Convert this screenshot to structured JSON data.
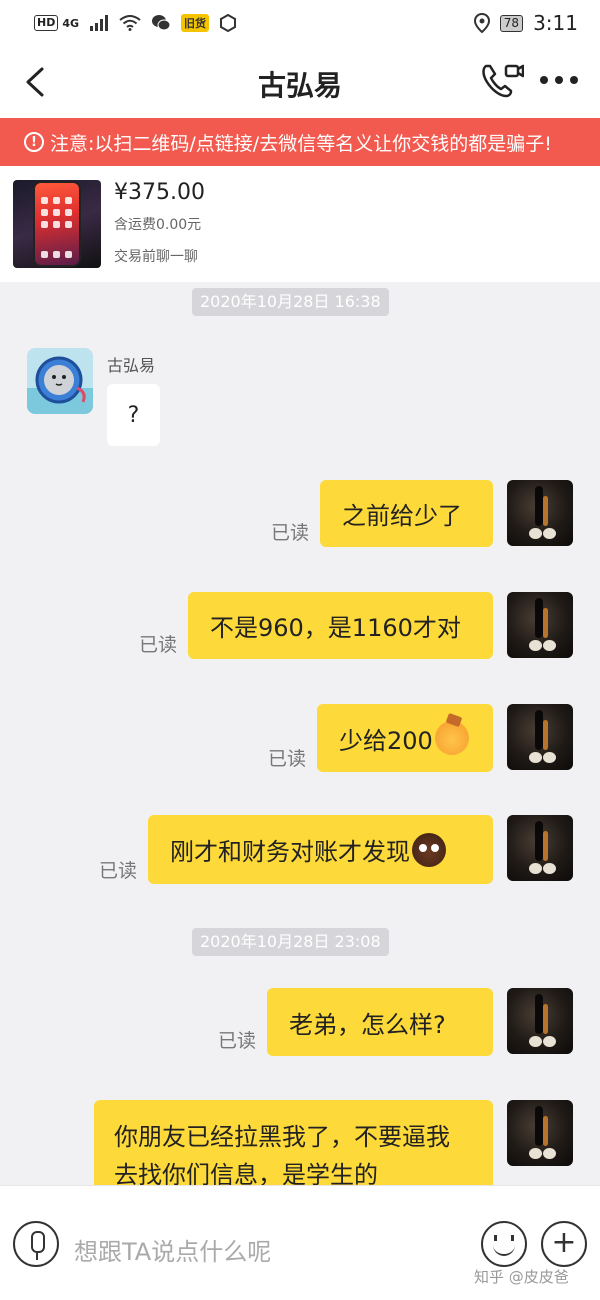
{
  "status_bar": {
    "hd": "HD",
    "network": "4G",
    "app_badge": "旧货",
    "battery": "78",
    "time": "3:11"
  },
  "header": {
    "title": "古弘易"
  },
  "warning": {
    "text": "注意:以扫二维码/点链接/去微信等名义让你交钱的都是骗子!"
  },
  "product": {
    "price": "¥375.00",
    "shipping": "含运费0.00元",
    "prompt": "交易前聊一聊"
  },
  "chat": {
    "timestamps": [
      "2020年10月28日 16:38",
      "2020年10月28日 23:08"
    ],
    "other": {
      "name": "古弘易",
      "message": "?"
    },
    "read_label": "已读",
    "messages": [
      {
        "text": "之前给少了"
      },
      {
        "text": "不是960，是1160才对"
      },
      {
        "text": "少给200",
        "emoji": "angry-emoji"
      },
      {
        "text": "刚才和财务对账才发现",
        "emoji": "sad-emoji"
      },
      {
        "text": "老弟，怎么样?"
      }
    ],
    "long_message": "你朋友已经拉黑我了，不要逼我去找你们信息，是学生的"
  },
  "input": {
    "placeholder": "想跟TA说点什么呢"
  },
  "watermark": "知乎 @皮皮爸"
}
